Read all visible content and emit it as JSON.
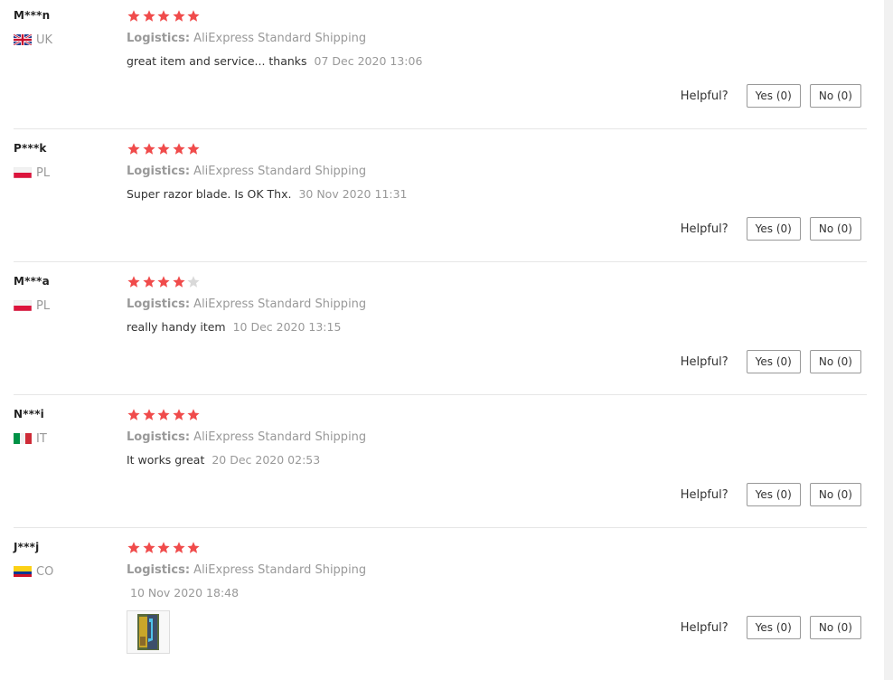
{
  "helpful_label": "Helpful?",
  "logistics_label": "Logistics:",
  "colors": {
    "star_filled": "#f04b4b",
    "star_empty": "#d9d9d9",
    "muted_text": "#999999"
  },
  "reviews": [
    {
      "user": "M***n",
      "country": "UK",
      "flag": "uk-flag-icon",
      "rating": 5,
      "shipping": "AliExpress Standard Shipping",
      "comment": "great item and service... thanks",
      "date": "07 Dec 2020 13:06",
      "yes": "Yes (0)",
      "no": "No (0)"
    },
    {
      "user": "P***k",
      "country": "PL",
      "flag": "pl-flag-icon",
      "rating": 5,
      "shipping": "AliExpress Standard Shipping",
      "comment": "Super razor blade. Is OK Thx.",
      "date": "30 Nov 2020 11:31",
      "yes": "Yes (0)",
      "no": "No (0)"
    },
    {
      "user": "M***a",
      "country": "PL",
      "flag": "pl-flag-icon",
      "rating": 4,
      "shipping": "AliExpress Standard Shipping",
      "comment": "really handy item",
      "date": "10 Dec 2020 13:15",
      "yes": "Yes (0)",
      "no": "No (0)"
    },
    {
      "user": "N***i",
      "country": "IT",
      "flag": "it-flag-icon",
      "rating": 5,
      "shipping": "AliExpress Standard Shipping",
      "comment": "It works great",
      "date": "20 Dec 2020 02:53",
      "yes": "Yes (0)",
      "no": "No (0)"
    },
    {
      "user": "J***j",
      "country": "CO",
      "flag": "co-flag-icon",
      "rating": 5,
      "shipping": "AliExpress Standard Shipping",
      "comment": "",
      "date": "10 Nov 2020 18:48",
      "yes": "Yes (0)",
      "no": "No (0)",
      "has_photo": true,
      "photo": "review-photo-thumbnail"
    }
  ]
}
